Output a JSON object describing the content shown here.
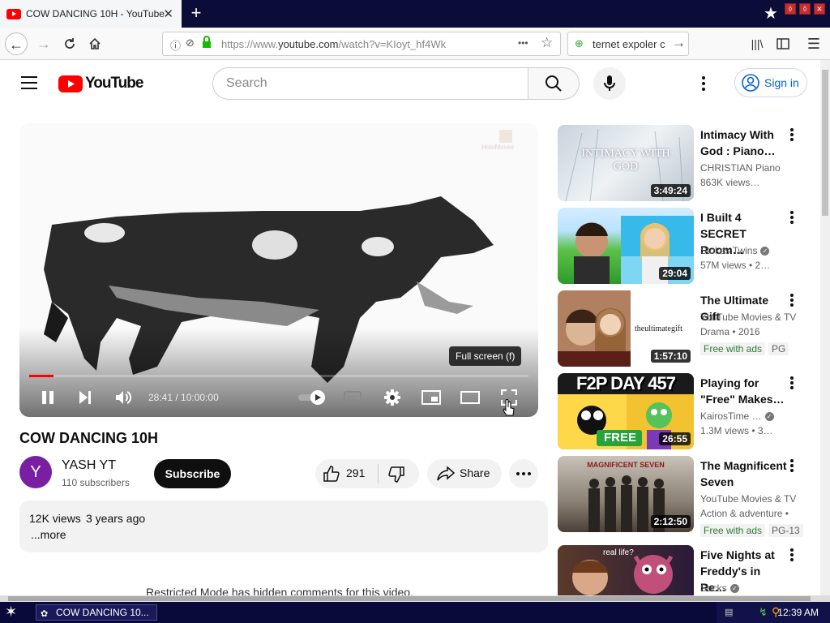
{
  "browser": {
    "tab_title": "COW DANCING 10H - YouTube",
    "tab_close": "✕",
    "new_tab": "+",
    "url_prefix": "https://www.",
    "url_domain": "youtube.com",
    "url_path": "/watch?v=KIoyt_hf4Wk",
    "search_text": "ternet expoler c",
    "page_actions": "•••"
  },
  "youtube": {
    "logo_text": "YouTube",
    "search_placeholder": "Search",
    "signin_label": "Sign in"
  },
  "player": {
    "tooltip": "Full screen (f)",
    "time_current": "28:41",
    "time_sep": " / ",
    "time_total": "10:00:00",
    "progress_fraction": 0.048,
    "watermark": "HoloMoves"
  },
  "video": {
    "title": "COW DANCING 10H",
    "channel_initial": "Y",
    "channel_name": "YASH YT",
    "subscribers": "110 subscribers",
    "subscribe_label": "Subscribe",
    "like_count": "291",
    "share_label": "Share",
    "views": "12K views",
    "age": "3 years ago",
    "more_label": "...more",
    "restricted_text": "Restricted Mode has hidden comments for this video."
  },
  "recommendations": [
    {
      "title": "Intimacy With God : Piano…",
      "channel": "CHRISTIAN Piano",
      "meta": "863K views…",
      "duration": "3:49:24",
      "thumb_text": "INTIMACY WITH GOD",
      "verified": false
    },
    {
      "title": "I Built 4 SECRET Room…",
      "channel": "Stokes Twins",
      "meta": "57M views  • 2…",
      "duration": "29:04",
      "verified": true
    },
    {
      "title": "The Ultimate Gift",
      "channel": "YouTube Movies & TV",
      "meta": "Drama • 2016",
      "duration": "1:57:10",
      "thumb_text": "theultimategift",
      "badge1": "Free with ads",
      "badge2": "PG",
      "verified": false
    },
    {
      "title": "Playing for \"Free\" Makes…",
      "channel": "KairosTime …",
      "meta": "1.3M views  • 3…",
      "duration": "26:55",
      "thumb_text": "F2P DAY 457",
      "thumb_sub": "FREE",
      "verified": true
    },
    {
      "title": "The Magnificent Seven",
      "channel": "YouTube Movies & TV",
      "meta": "Action & adventure •",
      "duration": "2:12:50",
      "thumb_text": "MAGNIFICENT SEVEN",
      "badge1": "Free with ads",
      "badge2": "PG-13",
      "verified": false
    },
    {
      "title": "Five Nights at Freddy's in Re…",
      "channel": "Socks",
      "meta": "",
      "duration": "",
      "thumb_text": "real life?",
      "verified": true
    }
  ],
  "taskbar": {
    "item_label": "COW DANCING 10...",
    "clock": "12:39 AM"
  },
  "colors": {
    "yt_red": "#ff0000",
    "link_blue": "#065fd4",
    "taskbar": "#0a0a3a",
    "free_green": "#2e7d32"
  }
}
